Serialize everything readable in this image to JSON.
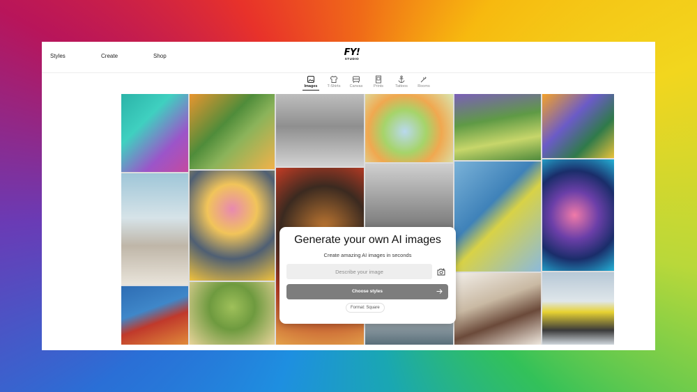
{
  "header": {
    "nav": [
      "Styles",
      "Create",
      "Shop"
    ],
    "logo": {
      "main": "FY!",
      "sub": "STUDIO"
    }
  },
  "categories": [
    {
      "label": "Images",
      "icon": "image-icon",
      "active": true
    },
    {
      "label": "T-Shirts",
      "icon": "tshirt-icon",
      "active": false
    },
    {
      "label": "Canvas",
      "icon": "canvas-icon",
      "active": false
    },
    {
      "label": "Prints",
      "icon": "print-icon",
      "active": false
    },
    {
      "label": "Tattoos",
      "icon": "anchor-icon",
      "active": false
    },
    {
      "label": "Rooms",
      "icon": "room-icon",
      "active": false
    }
  ],
  "generator": {
    "title": "Generate your own AI images",
    "subtitle": "Create amazing AI images in seconds",
    "input_placeholder": "Describe your image",
    "input_value": "",
    "button_label": "Choose styles",
    "format_label": "Format: Square"
  },
  "colors": {
    "button_bg": "#7d7d7d",
    "input_bg": "#eeeeee",
    "text": "#111111"
  }
}
